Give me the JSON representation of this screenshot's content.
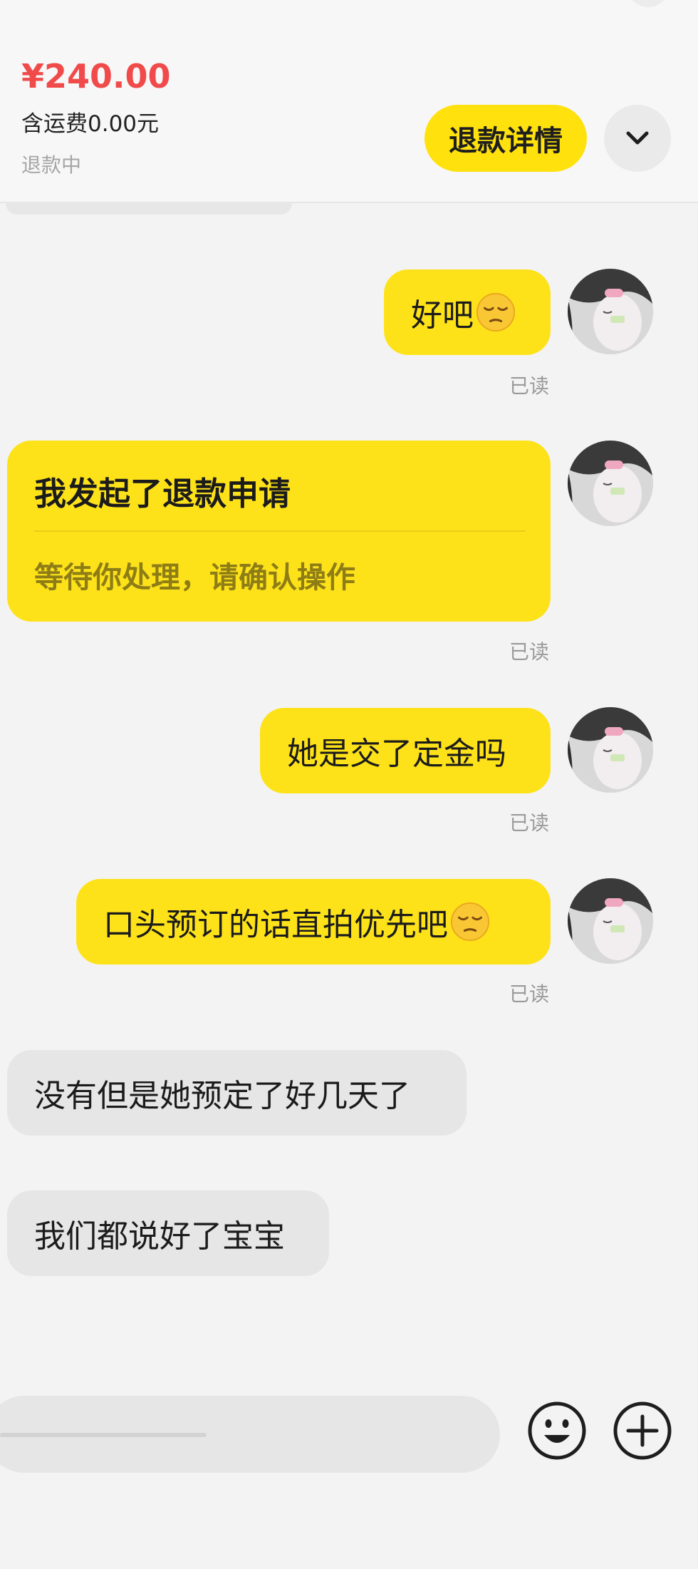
{
  "header": {
    "price": "¥240.00",
    "shipping": "含运费0.00元",
    "status": "退款中",
    "refund_details_label": "退款详情",
    "expand_icon": "chevron-down-icon"
  },
  "messages": [
    {
      "sender": "me",
      "text": "好吧",
      "emoji": "pensive-face",
      "read": "已读"
    },
    {
      "sender": "me",
      "type": "refund-card",
      "title": "我发起了退款申请",
      "subtitle": "等待你处理，请确认操作",
      "read": "已读"
    },
    {
      "sender": "me",
      "text": "她是交了定金吗",
      "read": "已读"
    },
    {
      "sender": "me",
      "text": "口头预订的话直拍优先吧",
      "emoji": "pensive-face",
      "read": "已读"
    },
    {
      "sender": "them",
      "text": "没有但是她预定了好几天了"
    },
    {
      "sender": "them",
      "text": "我们都说好了宝宝"
    }
  ],
  "input_bar": {
    "emoji_icon": "smiley-icon",
    "plus_icon": "plus-icon"
  },
  "colors": {
    "accent_yellow": "#fde21a",
    "price_red": "#f04a4a",
    "bubble_gray": "#e6e6e6"
  }
}
